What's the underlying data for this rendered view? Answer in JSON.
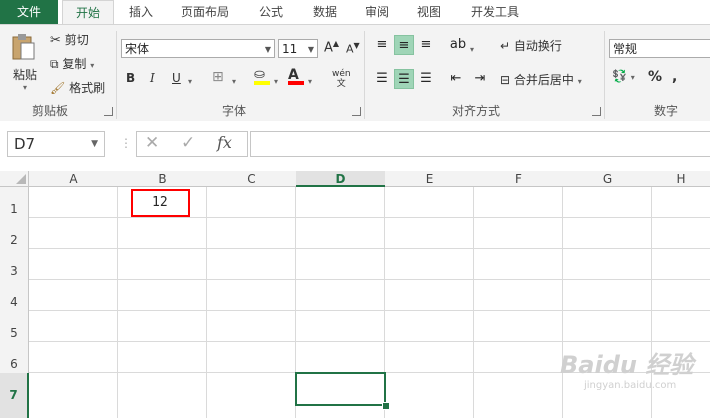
{
  "tabs": [
    "文件",
    "开始",
    "插入",
    "页面布局",
    "公式",
    "数据",
    "审阅",
    "视图",
    "开发工具"
  ],
  "clipboard": {
    "paste": "粘贴",
    "cut": "剪切",
    "copy": "复制",
    "format_painter": "格式刷",
    "label": "剪贴板"
  },
  "font": {
    "name": "宋体",
    "size": "11",
    "bold": "B",
    "italic": "I",
    "underline": "U",
    "phonetic": "wén",
    "label": "字体"
  },
  "alignment": {
    "wrap": "自动换行",
    "merge": "合并后居中",
    "label": "对齐方式"
  },
  "number": {
    "format": "常规",
    "percent": "%",
    "comma": ",",
    "label": "数字"
  },
  "formula_bar": {
    "name_box": "D7",
    "fx": "fx",
    "content": ""
  },
  "columns": [
    "A",
    "B",
    "C",
    "D",
    "E",
    "F",
    "G",
    "H"
  ],
  "rows": [
    "1",
    "2",
    "3",
    "4",
    "5",
    "6",
    "7"
  ],
  "cells": {
    "B1": "12"
  },
  "colors": {
    "accent": "#217346",
    "highlight": "#ff0000",
    "fill_yellow": "#ffff00",
    "font_red": "#ff0000"
  }
}
